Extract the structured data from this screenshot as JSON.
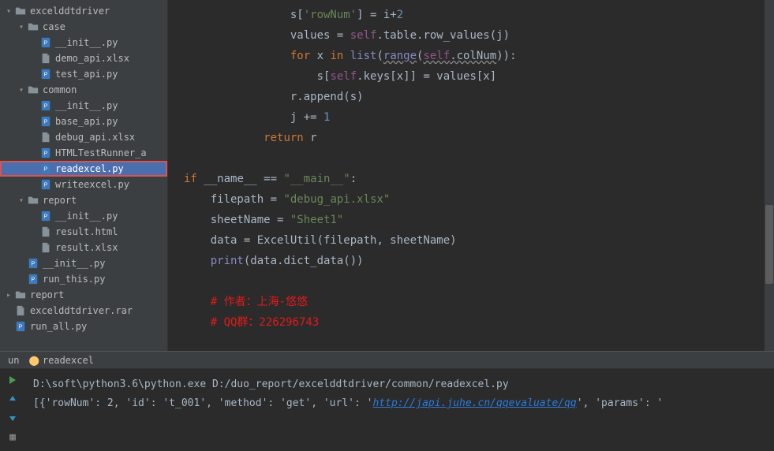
{
  "tree": [
    {
      "level": 0,
      "arrow": "down",
      "icon": "folder",
      "label": "excelddtdriver",
      "name": "project-root",
      "interact": true
    },
    {
      "level": 1,
      "arrow": "down",
      "icon": "folder",
      "label": "case",
      "name": "folder-case",
      "interact": true
    },
    {
      "level": 2,
      "arrow": "none",
      "icon": "py",
      "label": "__init__.py",
      "name": "file-init-case",
      "interact": true
    },
    {
      "level": 2,
      "arrow": "none",
      "icon": "file",
      "label": "demo_api.xlsx",
      "name": "file-demo-api",
      "interact": true
    },
    {
      "level": 2,
      "arrow": "none",
      "icon": "py",
      "label": "test_api.py",
      "name": "file-test-api",
      "interact": true
    },
    {
      "level": 1,
      "arrow": "down",
      "icon": "folder",
      "label": "common",
      "name": "folder-common",
      "interact": true
    },
    {
      "level": 2,
      "arrow": "none",
      "icon": "py",
      "label": "__init__.py",
      "name": "file-init-common",
      "interact": true
    },
    {
      "level": 2,
      "arrow": "none",
      "icon": "py",
      "label": "base_api.py",
      "name": "file-base-api",
      "interact": true
    },
    {
      "level": 2,
      "arrow": "none",
      "icon": "file",
      "label": "debug_api.xlsx",
      "name": "file-debug-api",
      "interact": true
    },
    {
      "level": 2,
      "arrow": "none",
      "icon": "py",
      "label": "HTMLTestRunner_a",
      "name": "file-htmltestrunner",
      "interact": true
    },
    {
      "level": 2,
      "arrow": "none",
      "icon": "py",
      "label": "readexcel.py",
      "name": "file-readexcel",
      "interact": true,
      "selected": true,
      "highlighted": true
    },
    {
      "level": 2,
      "arrow": "none",
      "icon": "py",
      "label": "writeexcel.py",
      "name": "file-writeexcel",
      "interact": true
    },
    {
      "level": 1,
      "arrow": "down",
      "icon": "folder",
      "label": "report",
      "name": "folder-report",
      "interact": true
    },
    {
      "level": 2,
      "arrow": "none",
      "icon": "py",
      "label": "__init__.py",
      "name": "file-init-report",
      "interact": true
    },
    {
      "level": 2,
      "arrow": "none",
      "icon": "file",
      "label": "result.html",
      "name": "file-result-html",
      "interact": true
    },
    {
      "level": 2,
      "arrow": "none",
      "icon": "file",
      "label": "result.xlsx",
      "name": "file-result-xlsx",
      "interact": true
    },
    {
      "level": 1,
      "arrow": "none",
      "icon": "py",
      "label": "__init__.py",
      "name": "file-init-root",
      "interact": true
    },
    {
      "level": 1,
      "arrow": "none",
      "icon": "py",
      "label": "run_this.py",
      "name": "file-run-this",
      "interact": true
    },
    {
      "level": 0,
      "arrow": "right",
      "icon": "folder",
      "label": "report",
      "name": "folder-report-outer",
      "interact": true
    },
    {
      "level": 0,
      "arrow": "none",
      "icon": "file",
      "label": "excelddtdriver.rar",
      "name": "file-rar",
      "interact": true
    },
    {
      "level": 0,
      "arrow": "none",
      "icon": "py",
      "label": "run_all.py",
      "name": "file-run-all",
      "interact": true
    }
  ],
  "code": [
    [
      {
        "t": "                s[",
        "c": "ident"
      },
      {
        "t": "'rowNum'",
        "c": "str"
      },
      {
        "t": "] = i+",
        "c": "ident"
      },
      {
        "t": "2",
        "c": "num"
      }
    ],
    [
      {
        "t": "                values = ",
        "c": "ident"
      },
      {
        "t": "self",
        "c": "self"
      },
      {
        "t": ".table.row_values(j)",
        "c": "ident"
      }
    ],
    [
      {
        "t": "                ",
        "c": "ident"
      },
      {
        "t": "for ",
        "c": "kw"
      },
      {
        "t": "x ",
        "c": "ident"
      },
      {
        "t": "in ",
        "c": "kw"
      },
      {
        "t": "list",
        "c": "builtin"
      },
      {
        "t": "(",
        "c": "ident"
      },
      {
        "t": "range",
        "c": "builtin",
        "u": true
      },
      {
        "t": "(",
        "c": "ident"
      },
      {
        "t": "self",
        "c": "self",
        "u": true
      },
      {
        "t": ".colNum",
        "c": "ident",
        "u": true
      },
      {
        "t": ")):",
        "c": "ident"
      }
    ],
    [
      {
        "t": "                    s[",
        "c": "ident"
      },
      {
        "t": "self",
        "c": "self"
      },
      {
        "t": ".keys[x]] = values[x]",
        "c": "ident"
      }
    ],
    [
      {
        "t": "                r.append(s)",
        "c": "ident"
      }
    ],
    [
      {
        "t": "                j += ",
        "c": "ident"
      },
      {
        "t": "1",
        "c": "num"
      }
    ],
    [
      {
        "t": "            ",
        "c": "ident"
      },
      {
        "t": "return ",
        "c": "kw"
      },
      {
        "t": "r",
        "c": "ident"
      }
    ],
    [
      {
        "t": " ",
        "c": "ident"
      }
    ],
    [
      {
        "t": "if ",
        "c": "kw"
      },
      {
        "t": "__name__ == ",
        "c": "ident"
      },
      {
        "t": "\"__main__\"",
        "c": "str"
      },
      {
        "t": ":",
        "c": "ident"
      }
    ],
    [
      {
        "t": "    filepath = ",
        "c": "ident"
      },
      {
        "t": "\"debug_api.xlsx\"",
        "c": "str"
      }
    ],
    [
      {
        "t": "    sheetName = ",
        "c": "ident"
      },
      {
        "t": "\"Sheet1\"",
        "c": "str"
      }
    ],
    [
      {
        "t": "    data = ExcelUtil(filepath",
        "c": "ident"
      },
      {
        "t": ", ",
        "c": "op"
      },
      {
        "t": "sheetName)",
        "c": "ident"
      }
    ],
    [
      {
        "t": "    ",
        "c": "ident"
      },
      {
        "t": "print",
        "c": "builtin"
      },
      {
        "t": "(data.dict_data())",
        "c": "ident"
      }
    ],
    [
      {
        "t": " ",
        "c": "ident"
      }
    ],
    [
      {
        "t": "    ",
        "c": "ident"
      },
      {
        "t": "# 作者：上海-悠悠",
        "c": "comment"
      }
    ],
    [
      {
        "t": "    ",
        "c": "ident"
      },
      {
        "t": "# QQ群：226296743",
        "c": "comment"
      }
    ]
  ],
  "terminal_tab": {
    "left": "un",
    "right": "readexcel"
  },
  "terminal_lines": [
    {
      "plain": "D:\\soft\\python3.6\\python.exe D:/duo_report/excelddtdriver/common/readexcel.py"
    },
    {
      "segments": [
        {
          "t": "[{'rowNum': 2, 'id': 't_001', 'method': 'get', 'url': '"
        },
        {
          "t": "http://japi.juhe.cn/qqevaluate/qq",
          "link": true
        },
        {
          "t": "', 'params': '"
        }
      ]
    }
  ]
}
